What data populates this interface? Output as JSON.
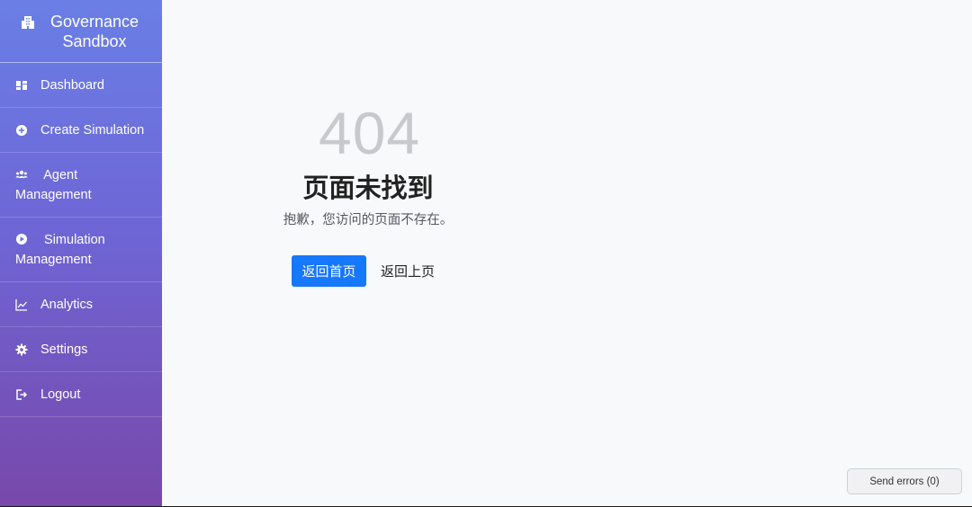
{
  "brand": {
    "title": "Governance Sandbox",
    "icon": "building-icon"
  },
  "sidebar": {
    "items": [
      {
        "label": "Dashboard",
        "icon": "dashboard-icon"
      },
      {
        "label": "Create Simulation",
        "icon": "plus-circle-icon"
      },
      {
        "label": "Agent Management",
        "icon": "users-icon"
      },
      {
        "label": "Simulation Management",
        "icon": "play-circle-icon"
      },
      {
        "label": "Analytics",
        "icon": "chart-line-icon"
      },
      {
        "label": "Settings",
        "icon": "gear-icon"
      },
      {
        "label": "Logout",
        "icon": "logout-icon"
      }
    ]
  },
  "error_page": {
    "code": "404",
    "title": "页面未找到",
    "description": "抱歉，您访问的页面不存在。",
    "home_button": "返回首页",
    "back_button": "返回上页"
  },
  "send_errors": {
    "label": "Send errors (0)"
  },
  "colors": {
    "sidebar_top": "#6a7fe6",
    "sidebar_bottom": "#7848aa",
    "primary": "#1677ff",
    "error_code": "#c8c9cc",
    "background": "#f8f9fb"
  }
}
